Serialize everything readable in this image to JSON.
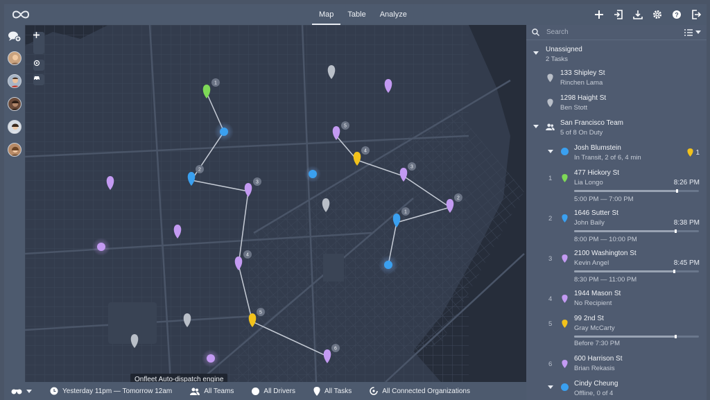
{
  "nav": {
    "tabs": [
      {
        "label": "Map",
        "active": true
      },
      {
        "label": "Table"
      },
      {
        "label": "Analyze"
      }
    ]
  },
  "toolbar": {
    "icons": [
      "plus-icon",
      "import-icon",
      "download-icon",
      "gear-icon",
      "help-icon",
      "logout-icon"
    ]
  },
  "tooltip": "Onfleet Auto-dispatch engine",
  "bottom": {
    "time_range": "Yesterday 11pm — Tomorrow 12am",
    "teams": "All Teams",
    "drivers": "All Drivers",
    "tasks": "All Tasks",
    "orgs": "All Connected Organizations"
  },
  "colors": {
    "green": "#7ed957",
    "blue": "#3aa0f0",
    "purple": "#c39af2",
    "yellow": "#f2c21b",
    "gray": "#b9bfc8"
  },
  "panel": {
    "search_placeholder": "Search",
    "unassigned": {
      "title": "Unassigned",
      "count": "2 Tasks",
      "tasks": [
        {
          "address": "133 Shipley St",
          "name": "Rinchen Lama"
        },
        {
          "address": "1298 Haight St",
          "name": "Ben Stott"
        }
      ]
    },
    "team": {
      "title": "San Francisco Team",
      "status": "5 of 8 On Duty"
    },
    "driver1": {
      "name": "Josh Blumstein",
      "status": "In Transit, 2 of 6, 4 min",
      "badge": "1"
    },
    "tasks": [
      {
        "index": "1",
        "address": "477 Hickory St",
        "name": "Lia Longo",
        "eta": "8:26 PM",
        "window": "5:00 PM — 7:00 PM",
        "progress": 0.82
      },
      {
        "index": "2",
        "address": "1646 Sutter St",
        "name": "John Baily",
        "eta": "8:38 PM",
        "window": "8:00 PM — 10:00 PM",
        "progress": 0.81
      },
      {
        "index": "3",
        "address": "2100 Washington St",
        "name": "Kevin Angel",
        "eta": "8:45 PM",
        "window": "8:30 PM — 11:00 PM",
        "progress": 0.8
      },
      {
        "index": "4",
        "address": "1944 Mason St",
        "name": "No Recipient"
      },
      {
        "index": "5",
        "address": "99 2nd St",
        "name": "Gray McCarty",
        "window": "Before 7:30 PM",
        "progress": 0.81
      },
      {
        "index": "6",
        "address": "600 Harrison St",
        "name": "Brian Rekasis"
      }
    ],
    "driver2": {
      "name": "Cindy Cheung",
      "status": "Offline, 0 of 4"
    }
  },
  "map": {
    "pin_labels": [
      "1",
      "2",
      "3",
      "4",
      "5",
      "6",
      "1",
      "2",
      "3",
      "4",
      "5"
    ]
  }
}
